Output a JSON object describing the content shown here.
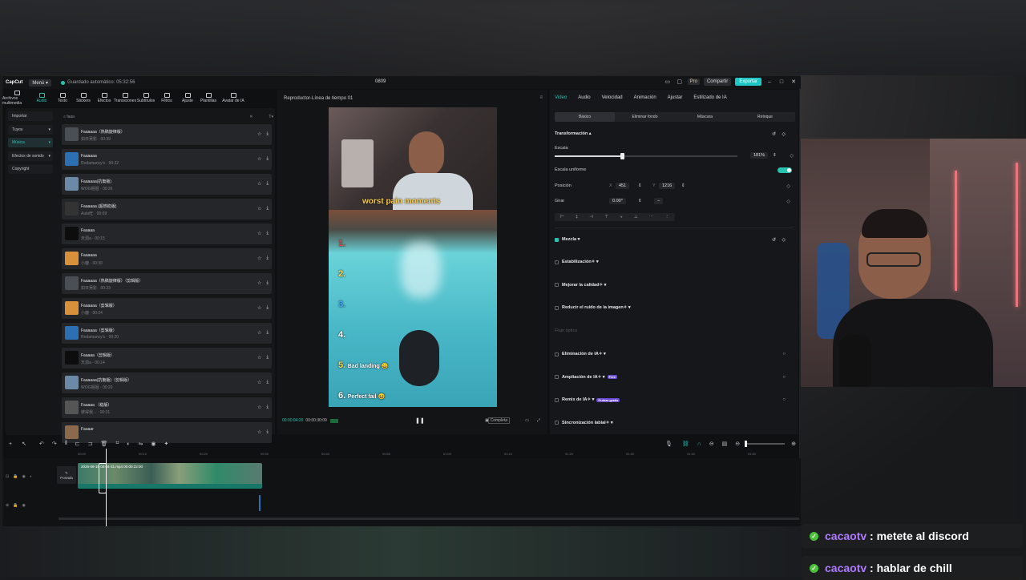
{
  "app": {
    "logo": "CapCut",
    "menu": "Menú ▾",
    "autosave": "Guardado automático: 05:32:56",
    "project_title": "0809",
    "pro": "Pro",
    "share": "Compartir",
    "export": "Exportar"
  },
  "tool_tabs": [
    "Archivos multimedia",
    "Audio",
    "Texto",
    "Stickers",
    "Efectos",
    "Transiciones",
    "Subtítulos",
    "Filtros",
    "Ajuste",
    "Plantillas",
    "Avatar de IA"
  ],
  "categories": [
    "Importar",
    "Tuyos",
    "Música",
    "Efectos de sonido",
    "Copyright"
  ],
  "search_value": "faaa",
  "tracks": [
    {
      "name": "Faaaaaa（热稿旋律版）",
      "sub": "如日吴影 · 00:39",
      "color": "#4a4f55"
    },
    {
      "name": "Faaaaaa",
      "sub": "Rodamancy's · 00:32",
      "color": "#2d6fb3"
    },
    {
      "name": "Faaaaaa(抗衡版)",
      "sub": "WOG姐姐 · 00:26",
      "color": "#6a8aa8"
    },
    {
      "name": "Faaaaaa (超燃稳版)",
      "sub": "Auto旺 · 00:09",
      "color": "#333"
    },
    {
      "name": "Faaaaa",
      "sub": "天源a · 00:15",
      "color": "#0d0d0d"
    },
    {
      "name": "Faaaaaa",
      "sub": "小鹿 · 00:30",
      "color": "#d8903a"
    },
    {
      "name": "Faaaaaa（热稿旋律版）（剪辑版）",
      "sub": "如日吴影 · 00:23",
      "color": "#4a4f55"
    },
    {
      "name": "Faaaaaa（剪辑版）",
      "sub": "小鹿 · 00:24",
      "color": "#d8903a"
    },
    {
      "name": "Faaaaaa（剪辑版）",
      "sub": "Rodamancy's · 00:20",
      "color": "#2d6fb3"
    },
    {
      "name": "Faaaaa（剪辑版）",
      "sub": "天源a · 00:14",
      "color": "#0d0d0d"
    },
    {
      "name": "Faaaaaa(抗衡版)（剪辑版）",
      "sub": "WOG姐姐 · 00:20",
      "color": "#6a8aa8"
    },
    {
      "name": "Faaaaa （稳版）",
      "sub": "彼得我... · 00:31",
      "color": "#555"
    },
    {
      "name": "Faaaar",
      "sub": "",
      "color": "#8a6a4a"
    }
  ],
  "player": {
    "title": "Reproductor-Línea de tiempo 01",
    "current_time": "00:00:04:20",
    "total_time": "00:00:30:09",
    "caption": "worst pain moments",
    "ranks": [
      {
        "num": "1.",
        "text": ""
      },
      {
        "num": "2.",
        "text": ""
      },
      {
        "num": "3.",
        "text": ""
      },
      {
        "num": "4.",
        "text": ""
      },
      {
        "num": "5.",
        "text": "Bad landing 😄"
      },
      {
        "num": "6.",
        "text": "Perfect fail 😆"
      }
    ],
    "ratio_btn": "Completa"
  },
  "inspector": {
    "tabs": [
      "Video",
      "Audio",
      "Velocidad",
      "Animación",
      "Ajustar",
      "Estilizado de IA"
    ],
    "subtabs": [
      "Básico",
      "Eliminar fondo",
      "Máscara",
      "Retoque"
    ],
    "transform": "Transformación",
    "scale_label": "Escala",
    "scale_value": "181%",
    "scale_level": 0.37,
    "uniform_label": "Escala uniforme",
    "position_label": "Posición",
    "pos_x_label": "X",
    "pos_x": "451",
    "pos_y_label": "Y",
    "pos_y": "1216",
    "rotate_label": "Girar",
    "rotate_value": "0.00°",
    "rotate_dash": "–",
    "blend": "Mezcla",
    "options": [
      {
        "label": "Estabilización",
        "tag": ""
      },
      {
        "label": "Mejorar la calidad",
        "tag": ""
      },
      {
        "label": "Reducir el ruido de la imagen",
        "tag": ""
      }
    ],
    "optical_flow": "Flujo óptico",
    "options2": [
      {
        "label": "Eliminación de IA",
        "tag": ""
      },
      {
        "label": "Ampliación de IA",
        "tag": "Free"
      },
      {
        "label": "Remix de IA",
        "tag": "Probar gratis"
      },
      {
        "label": "Sincronización labial",
        "tag": ""
      }
    ]
  },
  "timeline": {
    "ruler": [
      "00:00",
      "00:10",
      "00:20",
      "00:30",
      "00:40",
      "00:50",
      "01:00",
      "01:10",
      "01:20",
      "01:30",
      "01:40",
      "01:50"
    ],
    "clip_label": "2026-08-15 00:04-31.mp4  00:00:22:00",
    "cover": "Portada"
  },
  "chat": [
    {
      "user": "cacaotv",
      "message": ": metete al discord"
    },
    {
      "user": "cacaotv",
      "message": ": hablar de chill"
    }
  ]
}
